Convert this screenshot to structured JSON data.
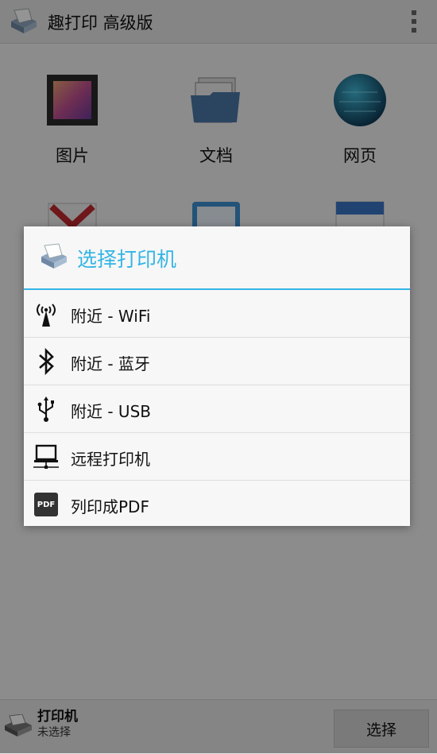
{
  "app": {
    "title": "趣打印 高级版"
  },
  "tiles": [
    {
      "label": "图片",
      "icon": "picture-icon"
    },
    {
      "label": "文档",
      "icon": "documents-icon"
    },
    {
      "label": "网页",
      "icon": "globe-icon"
    },
    {
      "label": "",
      "icon": "gmail-icon"
    },
    {
      "label": "",
      "icon": "cloud-storage-icon"
    },
    {
      "label": "",
      "icon": "calendar-icon"
    }
  ],
  "bottom_bar": {
    "printer_title": "打印机",
    "printer_status": "未选择",
    "select_label": "选择"
  },
  "dialog": {
    "title": "选择打印机",
    "accent_color": "#33b5e5",
    "options": [
      {
        "label": "附近 - WiFi",
        "icon": "wifi-antenna-icon"
      },
      {
        "label": "附近 - 蓝牙",
        "icon": "bluetooth-icon"
      },
      {
        "label": "附近 - USB",
        "icon": "usb-icon"
      },
      {
        "label": "远程打印机",
        "icon": "remote-computer-icon"
      },
      {
        "label": "列印成PDF",
        "icon": "pdf-icon"
      }
    ]
  },
  "pdf_icon_text": "PDF"
}
